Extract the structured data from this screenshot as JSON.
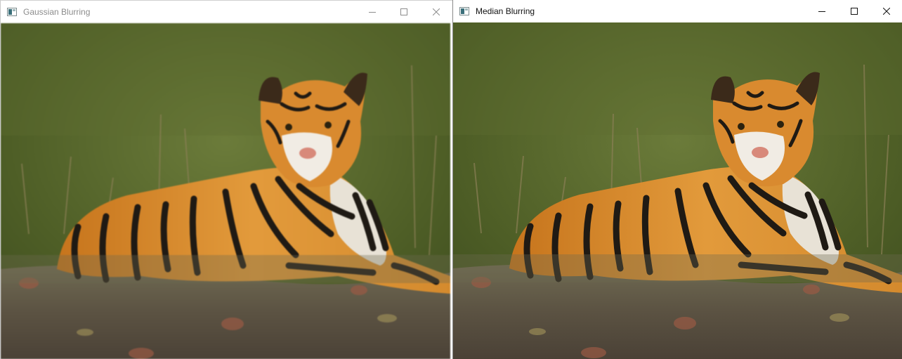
{
  "windows": [
    {
      "title": "Gaussian Blurring",
      "active": false,
      "icon": "app-icon",
      "controls": [
        "minimize-icon",
        "maximize-icon",
        "close-icon"
      ]
    },
    {
      "title": "Median Blurring",
      "active": true,
      "icon": "app-icon",
      "controls": [
        "minimize-icon",
        "maximize-icon",
        "close-icon"
      ]
    }
  ],
  "image": {
    "subject": "tiger",
    "icon": "tiger-photo"
  },
  "colors": {
    "inactive_title": "#8c8c8c",
    "active_title": "#111111",
    "titlebar": "#ffffff"
  }
}
